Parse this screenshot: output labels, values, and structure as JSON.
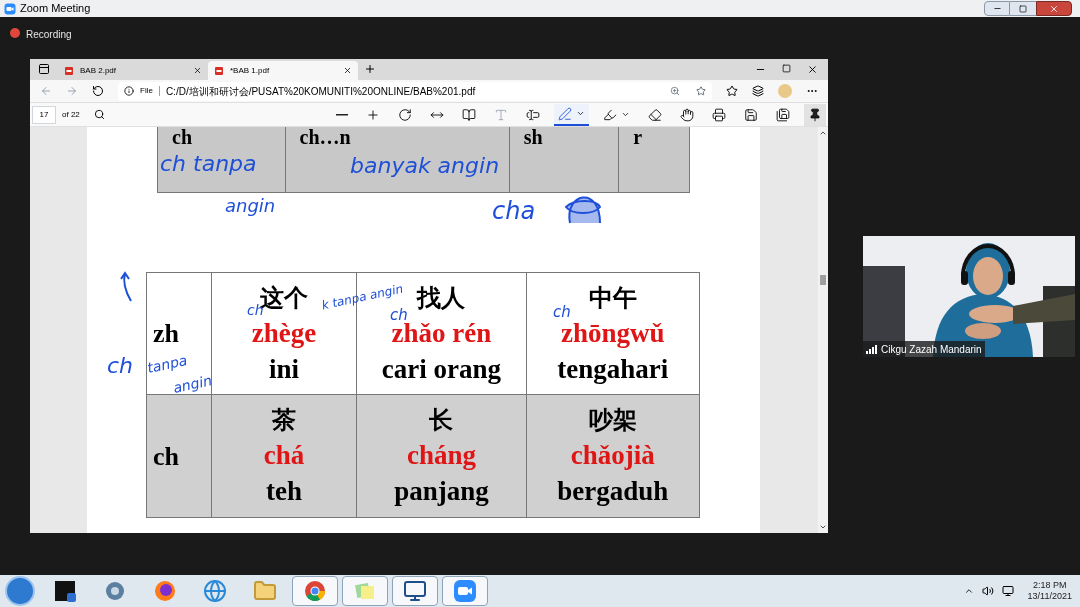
{
  "zoom_window": {
    "title": "Zoom Meeting",
    "recording_label": "Recording"
  },
  "browser": {
    "tabs": [
      {
        "title": "BAB 2.pdf",
        "selected": false
      },
      {
        "title": "*BAB 1.pdf",
        "selected": true
      }
    ],
    "address": {
      "scheme_label": "File",
      "url": "C:/D/培训和研讨会/PUSAT%20KOMUNITI%20ONLINE/BAB%201.pdf"
    },
    "pdf_toolbar": {
      "page": "17",
      "page_count": "of 22",
      "tools": [
        {
          "kind": "zoom-out",
          "selected": false
        },
        {
          "kind": "zoom-in",
          "selected": false
        },
        {
          "kind": "rotate",
          "selected": false
        },
        {
          "kind": "fit",
          "selected": false
        },
        {
          "kind": "page-view",
          "selected": false
        },
        {
          "kind": "read-aloud",
          "selected": false
        },
        {
          "kind": "text",
          "selected": false
        },
        {
          "kind": "draw",
          "selected": true
        },
        {
          "kind": "highlight",
          "selected": false
        },
        {
          "kind": "eraser",
          "selected": false
        },
        {
          "kind": "touch",
          "selected": false
        },
        {
          "kind": "print",
          "selected": false
        },
        {
          "kind": "save",
          "selected": false
        },
        {
          "kind": "save-as",
          "selected": false
        },
        {
          "kind": "pin",
          "selected": true
        }
      ]
    }
  },
  "document": {
    "top_table": {
      "cells": [
        "ch",
        "ch…n",
        "sh",
        "r"
      ]
    },
    "table": {
      "rows": [
        {
          "initial": "zh",
          "words": [
            {
              "hanzi": "这个",
              "pinyin": "zhège",
              "meaning": "ini"
            },
            {
              "hanzi": "找人",
              "pinyin": "zhǎo rén",
              "meaning": "cari orang"
            },
            {
              "hanzi": "中午",
              "pinyin": "zhōngwǔ",
              "meaning": "tengahari"
            }
          ]
        },
        {
          "initial": "ch",
          "words": [
            {
              "hanzi": "茶",
              "pinyin": "chá",
              "meaning": "teh"
            },
            {
              "hanzi": "长",
              "pinyin": "cháng",
              "meaning": "panjang"
            },
            {
              "hanzi": "吵架",
              "pinyin": "chǎojià",
              "meaning": "bergaduh"
            }
          ]
        }
      ]
    },
    "annotations": [
      "ch tanpa",
      "angin",
      "banyak angin",
      "cha",
      "ch",
      "tanpa",
      "angin",
      "ch",
      "k tanpa angin",
      "ch",
      "ch"
    ]
  },
  "video": {
    "participant_name": "Cikgu Zazah Mandarin"
  },
  "taskbar": {
    "apps": [
      {
        "kind": "d-app",
        "running": false
      },
      {
        "kind": "gear-app",
        "running": false
      },
      {
        "kind": "firefox",
        "running": false
      },
      {
        "kind": "ie",
        "running": false
      },
      {
        "kind": "folder",
        "running": false
      },
      {
        "kind": "chrome",
        "running": true
      },
      {
        "kind": "notes",
        "running": true
      },
      {
        "kind": "computer",
        "running": true
      },
      {
        "kind": "zoom",
        "running": true
      }
    ],
    "time": "2:18 PM",
    "date": "13/11/2021"
  }
}
